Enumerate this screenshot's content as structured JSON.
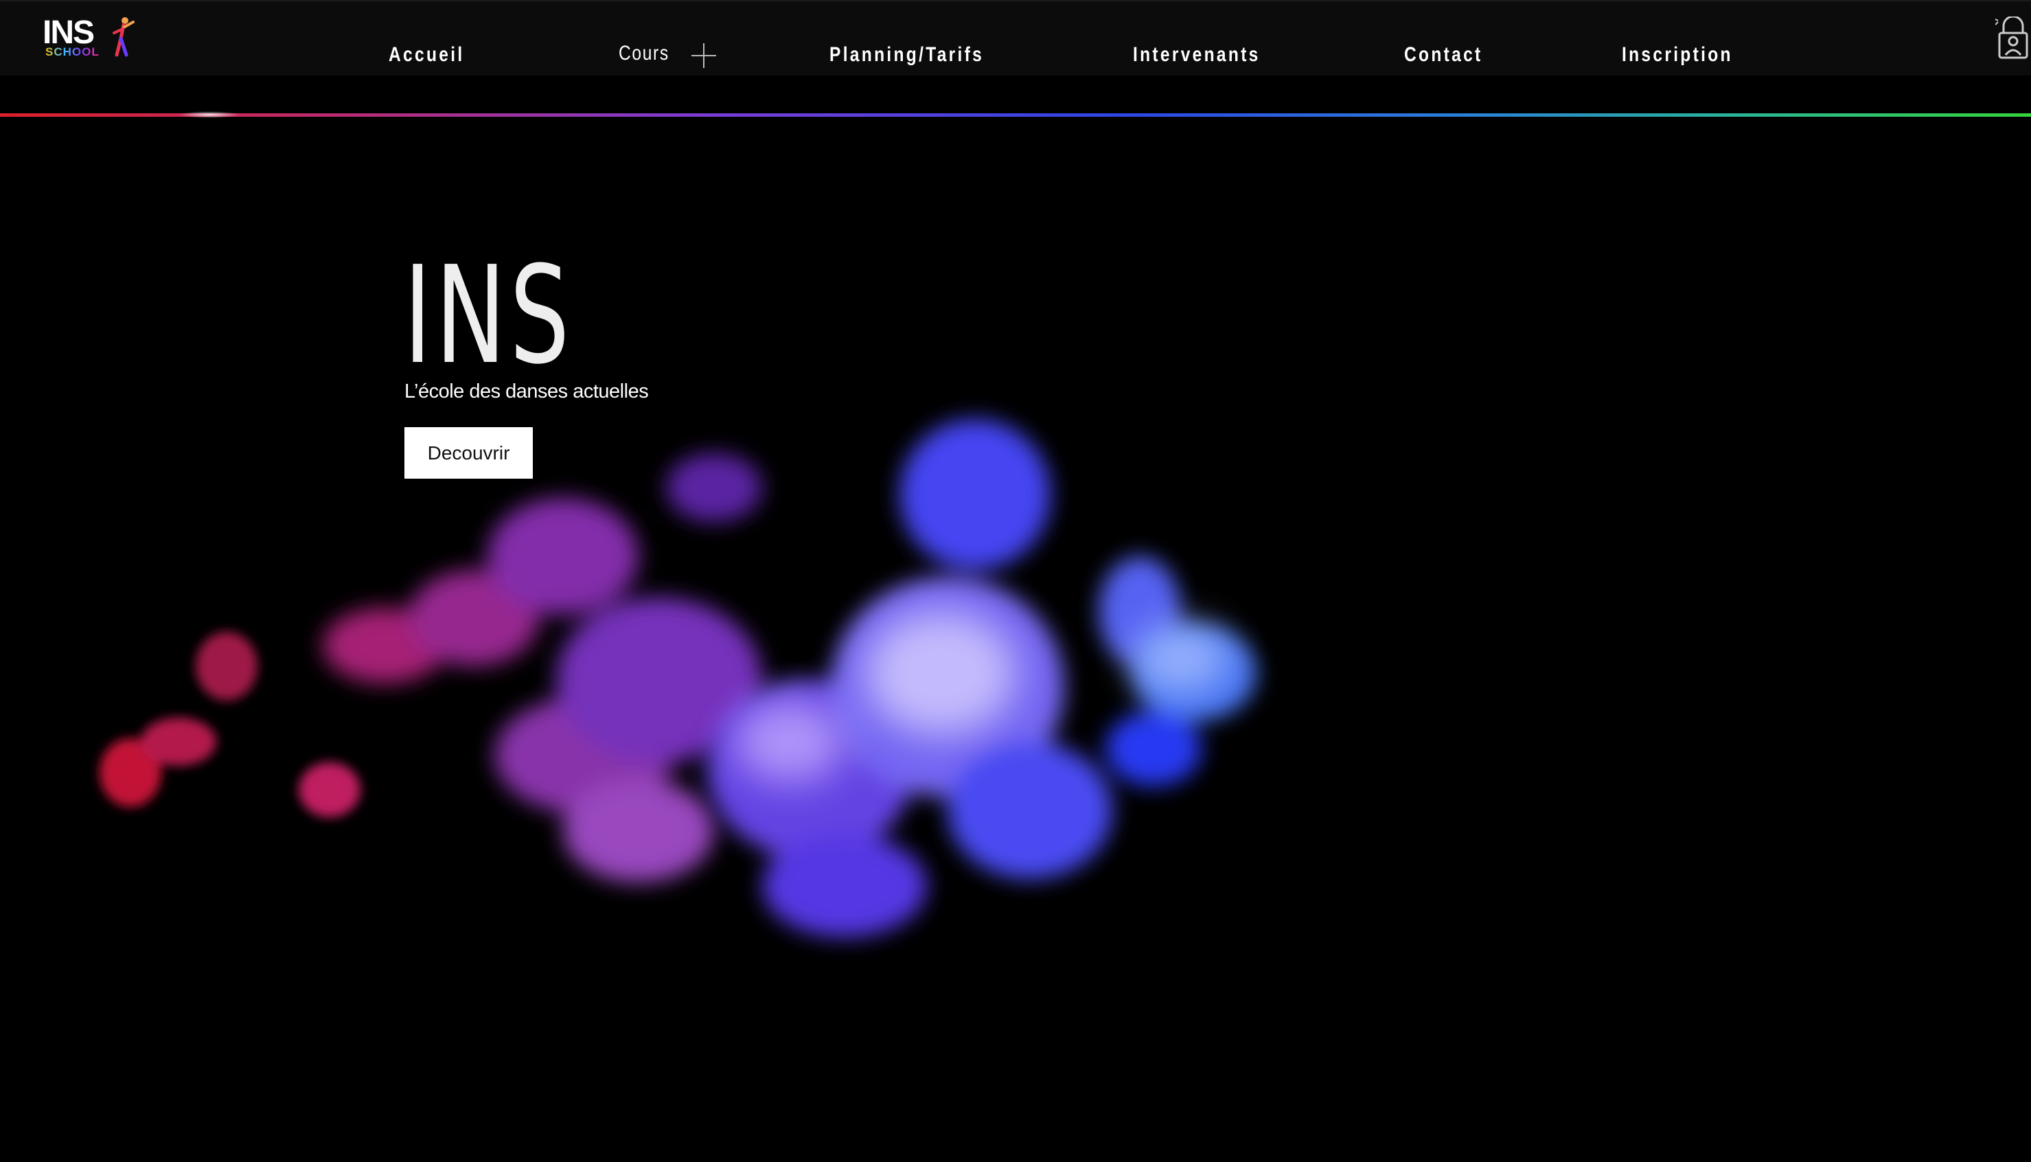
{
  "header": {
    "logo": {
      "text": "INS",
      "subtext": "SCHOOL"
    },
    "nav": [
      {
        "label": "Accueil"
      },
      {
        "label": "Cours",
        "has_submenu": true
      },
      {
        "label": "Planning/Tarifs"
      },
      {
        "label": "Intervenants"
      },
      {
        "label": "Contact"
      },
      {
        "label": "Inscription"
      }
    ]
  },
  "hero": {
    "title": "INS",
    "subtitle": "L’école des danses actuelles",
    "cta_label": "Decouvrir"
  },
  "icons": {
    "submenu": "plus-icon",
    "login": "login-user-icon"
  },
  "colors": {
    "background": "#000000",
    "header_background": "#0c0c0d",
    "button_background": "#ffffff",
    "line_gradient_start": "#e0202a",
    "line_gradient_mid": "#2d46e8",
    "line_gradient_end": "#35d43a",
    "smoke_red": "#e0203a",
    "smoke_magenta": "#a83ad8",
    "smoke_blue": "#3a4aff"
  }
}
